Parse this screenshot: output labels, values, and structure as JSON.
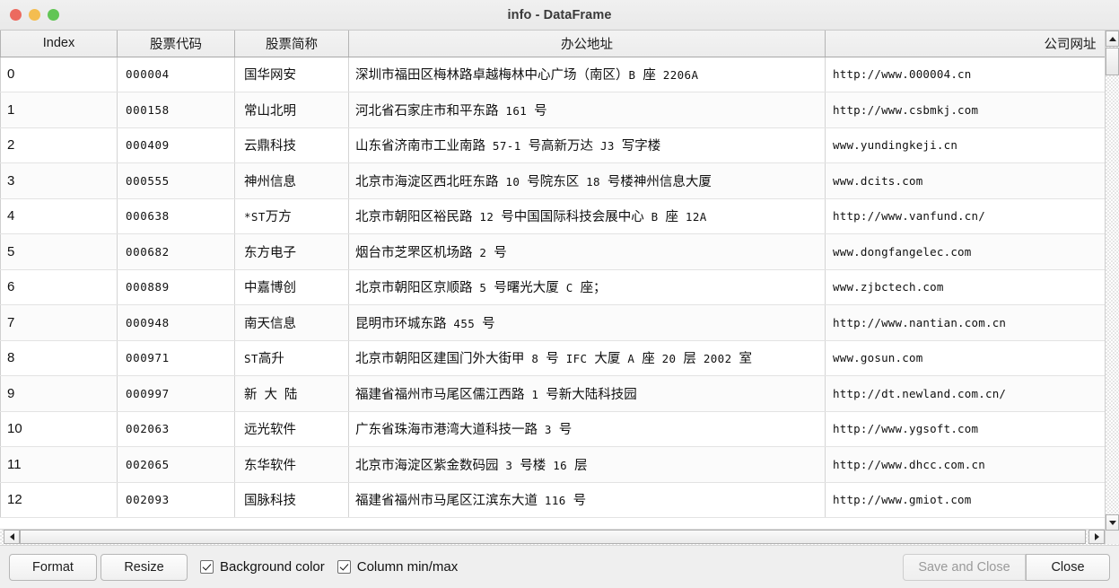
{
  "window": {
    "title": "info - DataFrame",
    "traffic_lights": {
      "close": "close-button",
      "minimize": "minimize-button",
      "maximize": "maximize-button"
    }
  },
  "table": {
    "columns": [
      {
        "key": "index",
        "label": "Index"
      },
      {
        "key": "code",
        "label": "股票代码"
      },
      {
        "key": "name",
        "label": "股票简称"
      },
      {
        "key": "addr",
        "label": "办公地址"
      },
      {
        "key": "web",
        "label": "公司网址"
      }
    ],
    "rows": [
      {
        "index": "0",
        "code": "000004",
        "name": "国华网安",
        "addr": "深圳市福田区梅林路卓越梅林中心广场（南区）B 座 2206A",
        "web": "http://www.000004.cn"
      },
      {
        "index": "1",
        "code": "000158",
        "name": "常山北明",
        "addr": "河北省石家庄市和平东路 161 号",
        "web": "http://www.csbmkj.com"
      },
      {
        "index": "2",
        "code": "000409",
        "name": "云鼎科技",
        "addr": "山东省济南市工业南路 57-1 号高新万达 J3 写字楼",
        "web": "www.yundingkeji.cn"
      },
      {
        "index": "3",
        "code": "000555",
        "name": "神州信息",
        "addr": "北京市海淀区西北旺东路 10 号院东区 18 号楼神州信息大厦",
        "web": "www.dcits.com"
      },
      {
        "index": "4",
        "code": "000638",
        "name": "*ST万方",
        "addr": "北京市朝阳区裕民路 12 号中国国际科技会展中心 B 座 12A",
        "web": "http://www.vanfund.cn/"
      },
      {
        "index": "5",
        "code": "000682",
        "name": "东方电子",
        "addr": "烟台市芝罘区机场路 2 号",
        "web": "www.dongfangelec.com"
      },
      {
        "index": "6",
        "code": "000889",
        "name": "中嘉博创",
        "addr": "北京市朝阳区京顺路 5 号曙光大厦 C 座；",
        "web": "www.zjbctech.com"
      },
      {
        "index": "7",
        "code": "000948",
        "name": "南天信息",
        "addr": "昆明市环城东路 455 号",
        "web": "http://www.nantian.com.cn"
      },
      {
        "index": "8",
        "code": "000971",
        "name": "ST高升",
        "addr": "北京市朝阳区建国门外大街甲 8 号 IFC 大厦 A 座 20 层 2002 室",
        "web": "www.gosun.com"
      },
      {
        "index": "9",
        "code": "000997",
        "name": "新 大 陆",
        "addr": "福建省福州市马尾区儒江西路 1 号新大陆科技园",
        "web": "http://dt.newland.com.cn/"
      },
      {
        "index": "10",
        "code": "002063",
        "name": "远光软件",
        "addr": "广东省珠海市港湾大道科技一路 3 号",
        "web": "http://www.ygsoft.com"
      },
      {
        "index": "11",
        "code": "002065",
        "name": "东华软件",
        "addr": "北京市海淀区紫金数码园 3 号楼 16 层",
        "web": "http://www.dhcc.com.cn"
      },
      {
        "index": "12",
        "code": "002093",
        "name": "国脉科技",
        "addr": "福建省福州市马尾区江滨东大道 116 号",
        "web": "http://www.gmiot.com"
      }
    ]
  },
  "scrollbars": {
    "vertical": {
      "up": "scroll-up",
      "down": "scroll-down"
    },
    "horizontal": {
      "left": "scroll-left",
      "right": "scroll-right"
    }
  },
  "toolbar": {
    "format_label": "Format",
    "resize_label": "Resize",
    "background_color": {
      "label": "Background color",
      "checked": true
    },
    "column_minmax": {
      "label": "Column min/max",
      "checked": true
    },
    "save_and_close_label": "Save and Close",
    "save_and_close_enabled": false,
    "close_label": "Close"
  },
  "colors": {
    "window_bg": "#efefef",
    "table_bg": "#ffffff",
    "header_bg": "#ececec",
    "text": "#101010",
    "disabled_text": "#9a9a9a",
    "traffic_red": "#ec6a5f",
    "traffic_yellow": "#f4bd50",
    "traffic_green": "#61c555"
  }
}
